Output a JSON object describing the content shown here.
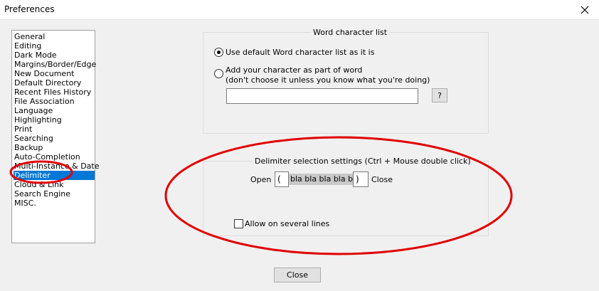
{
  "window": {
    "title": "Preferences",
    "close_glyph": "✕"
  },
  "sidebar": {
    "items": [
      {
        "label": "General"
      },
      {
        "label": "Editing"
      },
      {
        "label": "Dark Mode"
      },
      {
        "label": "Margins/Border/Edge"
      },
      {
        "label": "New Document"
      },
      {
        "label": "Default Directory"
      },
      {
        "label": "Recent Files History"
      },
      {
        "label": "File Association"
      },
      {
        "label": "Language"
      },
      {
        "label": "Highlighting"
      },
      {
        "label": "Print"
      },
      {
        "label": "Searching"
      },
      {
        "label": "Backup"
      },
      {
        "label": "Auto-Completion"
      },
      {
        "label": "Multi-Instance & Date"
      },
      {
        "label": "Delimiter"
      },
      {
        "label": "Cloud & Link"
      },
      {
        "label": "Search Engine"
      },
      {
        "label": "MISC."
      }
    ],
    "selected": "Delimiter"
  },
  "word_char": {
    "legend": "Word character list",
    "option_default": "Use default Word character list as it is",
    "option_custom_line1": "Add your character as part of word",
    "option_custom_line2": "(don't choose it unless you know what you're doing)",
    "selected_option": "default",
    "custom_value": "",
    "help_button": "?"
  },
  "delimiter": {
    "legend": "Delimiter selection settings (Ctrl + Mouse double click)",
    "open_label": "Open",
    "open_value": "(",
    "sample_text": "bla bla bla bla bla",
    "close_value": ")",
    "close_label": "Close",
    "multiline_label": "Allow on several lines",
    "multiline_checked": false
  },
  "footer": {
    "close_button": "Close"
  },
  "annotation": {
    "color": "#e00000"
  }
}
